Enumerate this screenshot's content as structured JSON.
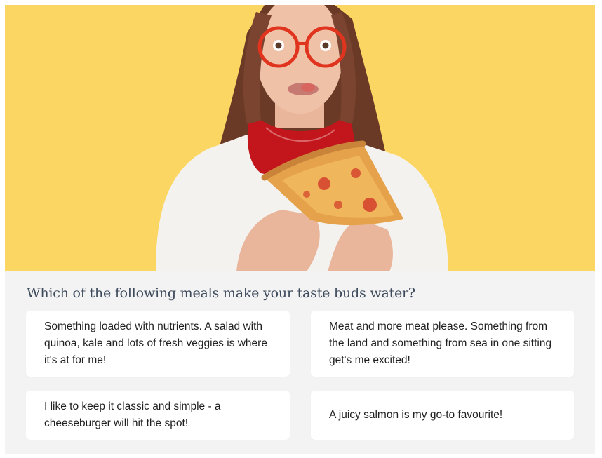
{
  "hero": {
    "image": "woman-eating-pizza-illustration",
    "background_color": "#fbd663"
  },
  "quiz": {
    "question": "Which of the following meals make your taste buds water?",
    "options": [
      {
        "label": "Something loaded with nutrients. A salad with quinoa, kale and lots of fresh veggies is where it's at for me!"
      },
      {
        "label": "Meat and more meat please. Something from the land and something from sea in one sitting get's me excited!"
      },
      {
        "label": "I like to keep it classic and simple - a cheeseburger will hit the spot!"
      },
      {
        "label": "A juicy salmon is my go-to favourite!"
      }
    ]
  },
  "colors": {
    "panel": "#f3f3f3",
    "question_text": "#3d4a5c",
    "option_bg": "#ffffff"
  }
}
